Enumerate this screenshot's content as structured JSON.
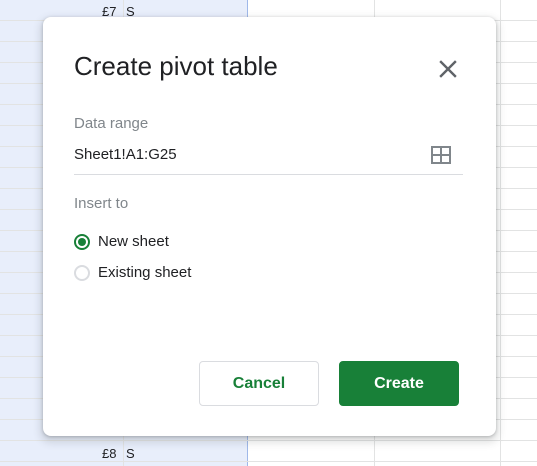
{
  "spreadsheet": {
    "top_cell_amount": "£7",
    "top_cell_code": "S",
    "bottom_cell_amount": "£8",
    "bottom_cell_code": "S"
  },
  "dialog": {
    "title": "Create pivot table",
    "close_icon": "close-icon",
    "data_range": {
      "label": "Data range",
      "value": "Sheet1!A1:G25",
      "icon": "grid-select-icon"
    },
    "insert_to": {
      "label": "Insert to",
      "options": [
        {
          "label": "New sheet",
          "checked": true
        },
        {
          "label": "Existing sheet",
          "checked": false
        }
      ]
    },
    "buttons": {
      "cancel_label": "Cancel",
      "create_label": "Create"
    }
  },
  "colors": {
    "accent": "#188038",
    "selection_fill": "#e8eefb",
    "gridline": "#e2e3e3"
  }
}
